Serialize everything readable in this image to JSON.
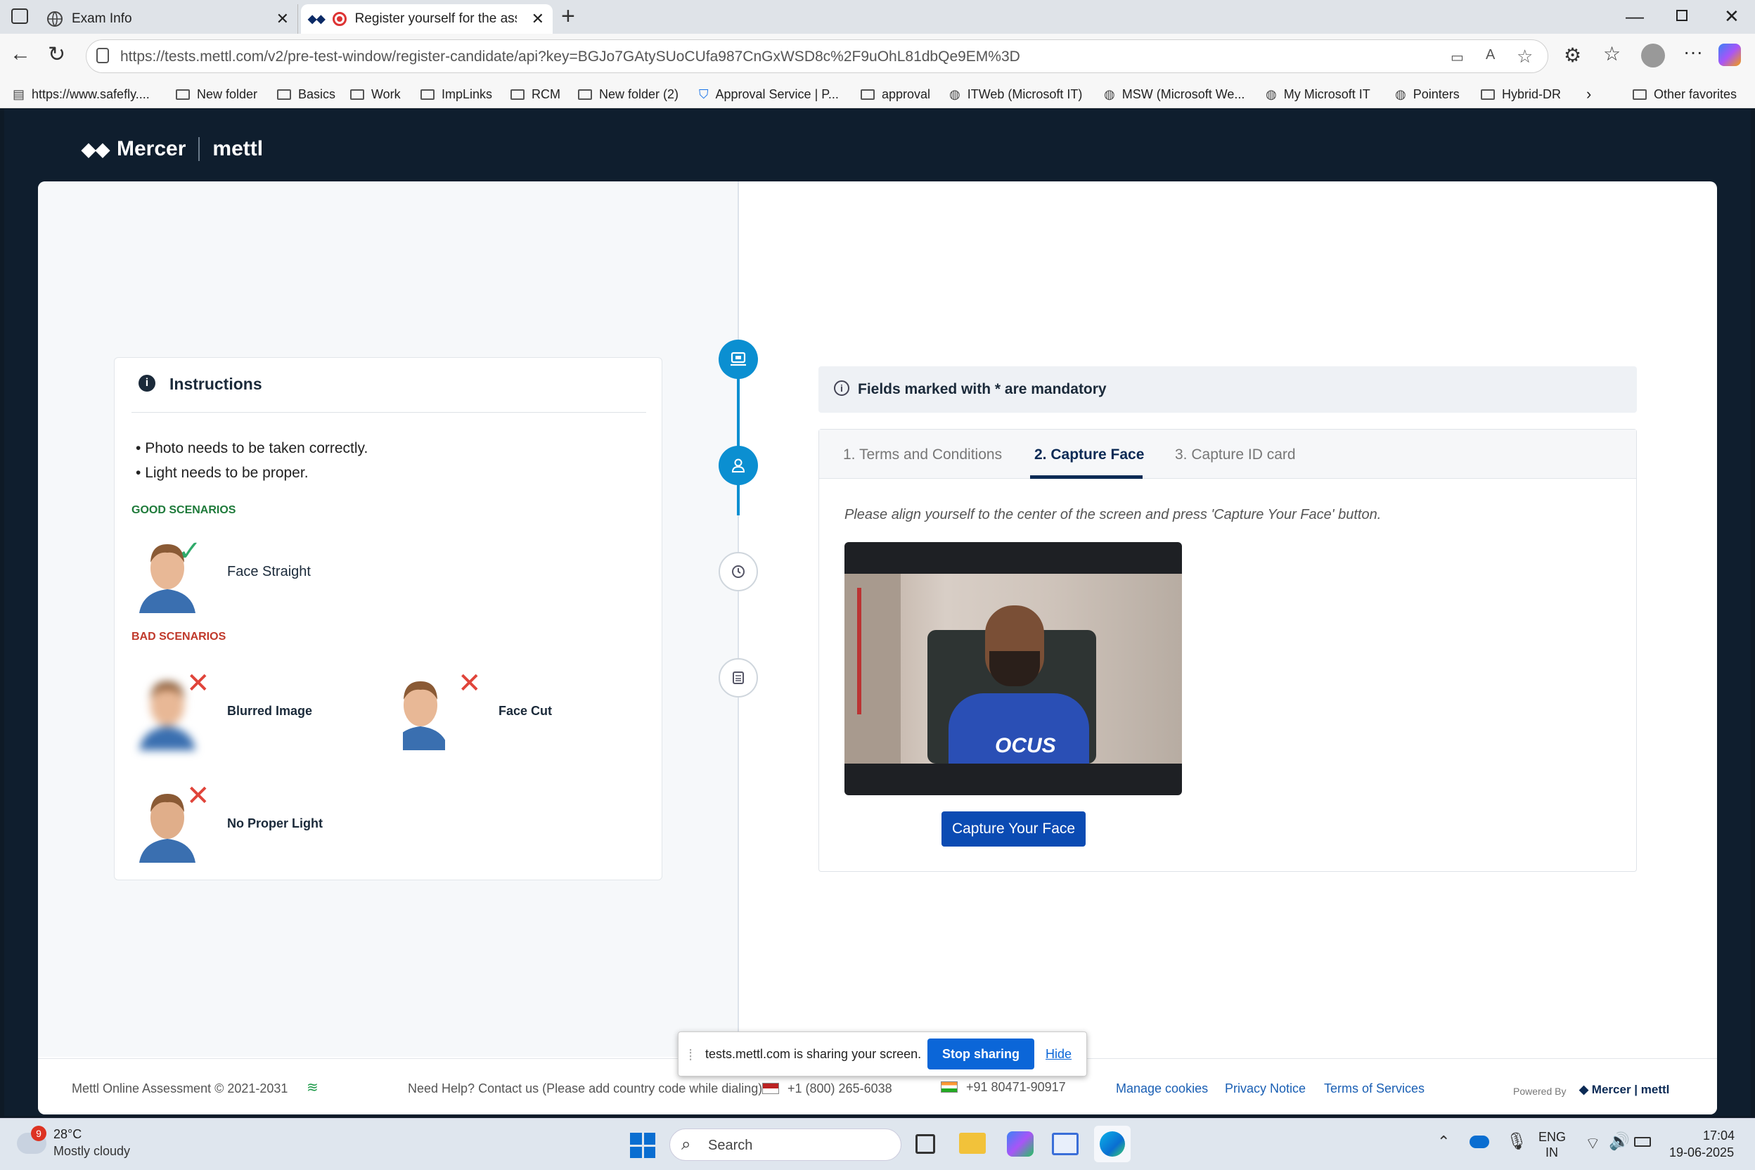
{
  "browser": {
    "tabs": [
      {
        "title": "Exam Info"
      },
      {
        "title": "Register yourself for the asse"
      }
    ],
    "url": "https://tests.mettl.com/v2/pre-test-window/register-candidate/api?key=BGJo7GAtySUoCUfa987CnGxWSD8c%2F9uOhL81dbQe9EM%3D",
    "bookmarks": [
      "https://www.safefly....",
      "New folder",
      "Basics",
      "Work",
      "ImpLinks",
      "RCM",
      "New folder (2)",
      "Approval Service | P...",
      "approval",
      "ITWeb (Microsoft IT)",
      "MSW (Microsoft We...",
      "My Microsoft IT",
      "Pointers",
      "Hybrid-DR"
    ],
    "other_favorites": "Other favorites"
  },
  "brand": {
    "mercer": "Mercer",
    "mettl": "mettl"
  },
  "instructions": {
    "title": "Instructions",
    "bullets": [
      "Photo needs to be taken correctly.",
      "Light needs to be proper."
    ],
    "good_label": "GOOD SCENARIOS",
    "good": [
      {
        "label": "Face Straight"
      }
    ],
    "bad_label": "BAD SCENARIOS",
    "bad": [
      {
        "label": "Blurred Image"
      },
      {
        "label": "Face Cut"
      },
      {
        "label": "No Proper Light"
      }
    ]
  },
  "mandatory_note": "Fields marked with * are mandatory",
  "tabs": [
    {
      "label": "1. Terms and Conditions",
      "active": false
    },
    {
      "label": "2. Capture Face",
      "active": true
    },
    {
      "label": "3. Capture ID card",
      "active": false
    }
  ],
  "capture": {
    "instruction": "Please align yourself to the center of the screen and press 'Capture Your Face' button.",
    "button": "Capture Your Face",
    "shirt_text": "OCUS"
  },
  "footer": {
    "copyright": "Mettl Online Assessment © 2021-2031",
    "help": "Need Help? Contact us (Please add country code while dialing)",
    "phone_us": "+1 (800) 265-6038",
    "phone_in": "+91 80471-90917",
    "links": [
      "Manage cookies",
      "Privacy Notice",
      "Terms of Services"
    ],
    "powered_by": "Powered By"
  },
  "share_bar": {
    "text": "tests.mettl.com is sharing your screen.",
    "stop": "Stop sharing",
    "hide": "Hide"
  },
  "taskbar": {
    "weather_badge": "9",
    "temp": "28°C",
    "weather": "Mostly cloudy",
    "search": "Search",
    "lang": "ENG",
    "region": "IN",
    "time": "17:04",
    "date": "19-06-2025"
  },
  "colors": {
    "accent": "#0b8fd1",
    "primary_button": "#0b4bb3",
    "good": "#1e7a3a",
    "bad": "#c0392b",
    "page_bg": "#0f1e2e"
  }
}
